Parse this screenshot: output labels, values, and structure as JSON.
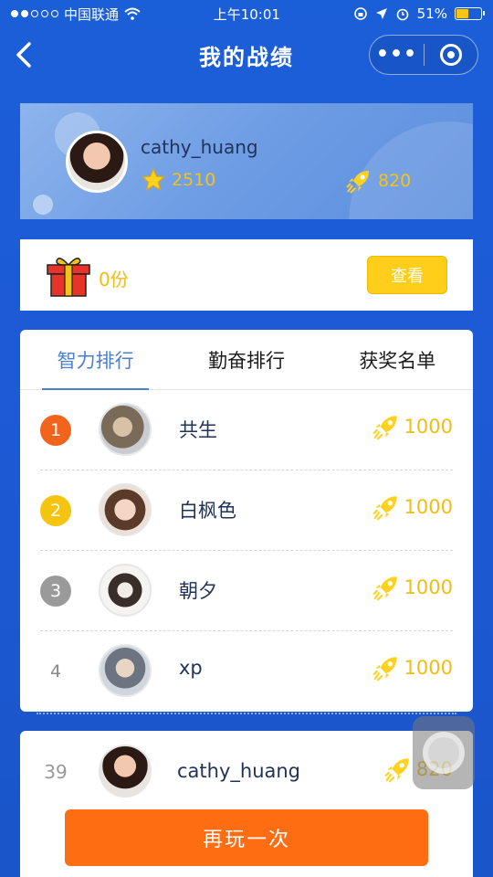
{
  "status_bar": {
    "carrier": "中国联通",
    "time": "上午10:01",
    "battery": "51%",
    "battery_level": 0.51
  },
  "nav": {
    "title": "我的战绩"
  },
  "profile": {
    "name": "cathy_huang",
    "stars": "2510",
    "rockets": "820"
  },
  "gift": {
    "count_text": "0份",
    "view_label": "查看"
  },
  "tabs": [
    {
      "label": "智力排行",
      "active": true
    },
    {
      "label": "勤奋排行",
      "active": false
    },
    {
      "label": "获奖名单",
      "active": false
    }
  ],
  "rankings": [
    {
      "rank": "1",
      "name": "共生",
      "score": "1000",
      "badge_color": "#f2641c"
    },
    {
      "rank": "2",
      "name": "白枫色",
      "score": "1000",
      "badge_color": "#f5c40f"
    },
    {
      "rank": "3",
      "name": "朝夕",
      "score": "1000",
      "badge_color": "#9a9a9a"
    },
    {
      "rank": "4",
      "name": "xp",
      "score": "1000",
      "badge_color": ""
    }
  ],
  "own_rank": {
    "rank": "39",
    "name": "cathy_huang",
    "score": "820"
  },
  "play_again_label": "再玩一次",
  "colors": {
    "accent": "#4b7fd0",
    "gold": "#f0bd12",
    "orange_button": "#ff6d13"
  }
}
